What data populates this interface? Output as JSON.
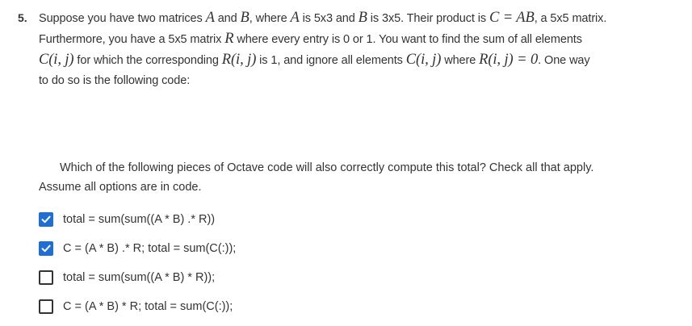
{
  "question": {
    "number": "5.",
    "line1": {
      "t1": "Suppose you have two matrices ",
      "A": "A",
      "t2": " and ",
      "B": "B",
      "t3": ", where ",
      "A2": "A",
      "t4": " is 5x3 and ",
      "B2": "B",
      "t5": " is 3x5. Their product is ",
      "C_eq_AB": "C = AB",
      "t6": ", a 5x5 matrix."
    },
    "line2": {
      "t1": "Furthermore, you have a 5x5 matrix ",
      "R": "R",
      "t2": " where every entry is 0 or 1. You want to find the sum of all elements"
    },
    "line3": {
      "Cij": "C(i, j)",
      "t1": " for which the corresponding ",
      "Rij": "R(i, j)",
      "t2": " is 1, and ignore all elements ",
      "Cij2": "C(i, j)",
      "t3": " where ",
      "Rij0": "R(i, j) = 0",
      "t4": ". One way"
    },
    "line4": "to do so is the following code:"
  },
  "followup": {
    "line1": "Which of the following pieces of Octave code will also correctly compute this total? Check all that apply.",
    "line2": "Assume all options are in code."
  },
  "options": [
    {
      "label": "total = sum(sum((A * B) .* R))",
      "checked": true
    },
    {
      "label": "C = (A * B) .* R; total = sum(C(:));",
      "checked": true
    },
    {
      "label": "total = sum(sum((A * B) * R));",
      "checked": false
    },
    {
      "label": "C = (A * B) * R; total = sum(C(:));",
      "checked": false
    }
  ],
  "colors": {
    "checkbox_checked": "#1f6ed4",
    "text": "#333333"
  }
}
